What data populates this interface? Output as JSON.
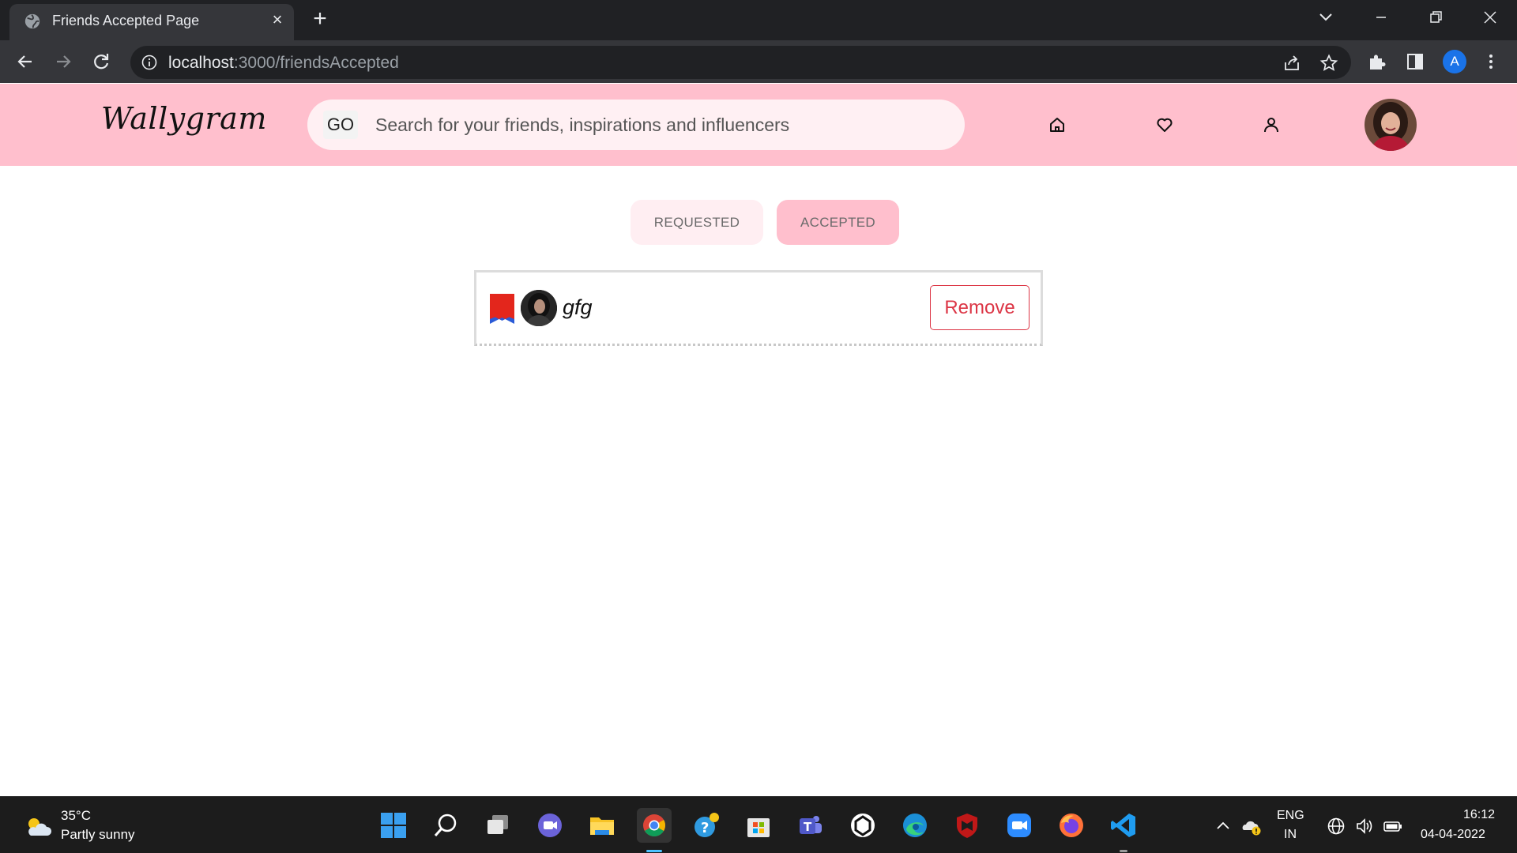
{
  "browser": {
    "tab_title": "Friends Accepted Page",
    "url_host": "localhost",
    "url_path": ":3000/friendsAccepted",
    "profile_initial": "A"
  },
  "navbar": {
    "logo": "Wallygram",
    "go_label": "GO",
    "search_placeholder": "Search for your friends, inspirations and influencers"
  },
  "tabs": {
    "requested": "REQUESTED",
    "accepted": "ACCEPTED"
  },
  "friends": [
    {
      "name": "gfg",
      "action_label": "Remove"
    }
  ],
  "taskbar": {
    "temperature": "35°C",
    "weather": "Partly sunny",
    "lang_line1": "ENG",
    "lang_line2": "IN",
    "time": "16:12",
    "date": "04-04-2022"
  },
  "colors": {
    "navbar_bg": "#ffbfcd",
    "accepted_tab_bg": "#ffbfcd",
    "requested_tab_bg": "#ffeef2",
    "remove_color": "#dc3545"
  }
}
